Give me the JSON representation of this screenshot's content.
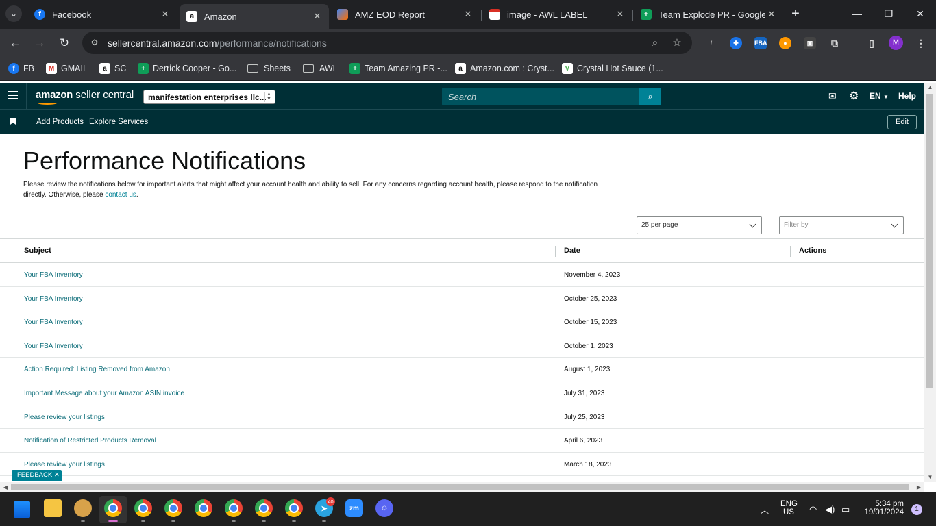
{
  "browser": {
    "tabs": [
      {
        "title": "Facebook",
        "icon": "facebook-icon",
        "color": "#1877f2",
        "glyph": "f"
      },
      {
        "title": "Amazon",
        "icon": "amazon-icon",
        "color": "#ffffff",
        "glyph": "a"
      },
      {
        "title": "AMZ EOD Report",
        "icon": "report-icon",
        "color": "#ff6f00",
        "glyph": ""
      },
      {
        "title": "image - AWL LABEL",
        "icon": "gmail-icon",
        "color": "#d93025",
        "glyph": ""
      },
      {
        "title": "Team Explode PR - Google S",
        "icon": "google-sheets-icon",
        "color": "#0f9d58",
        "glyph": "+"
      }
    ],
    "url_domain": "sellercentral.amazon.com",
    "url_path": "/performance/notifications",
    "profile_initial": "M",
    "bookmarks": [
      {
        "label": "FB",
        "icon": "facebook-icon"
      },
      {
        "label": "GMAIL",
        "icon": "gmail-icon"
      },
      {
        "label": "SC",
        "icon": "amazon-icon"
      },
      {
        "label": "Derrick Cooper - Go...",
        "icon": "google-sheets-icon"
      },
      {
        "label": "Sheets",
        "icon": "folder-icon"
      },
      {
        "label": "AWL",
        "icon": "folder-icon"
      },
      {
        "label": "Team Amazing PR -...",
        "icon": "google-sheets-icon"
      },
      {
        "label": "Amazon.com : Cryst...",
        "icon": "amazon-icon"
      },
      {
        "label": "Crystal Hot Sauce (1...",
        "icon": "vine-icon"
      }
    ]
  },
  "seller_central": {
    "logo_bold": "amazon",
    "logo_light": " seller central",
    "account": "manifestation enterprises llc...",
    "search_placeholder": "Search",
    "language": "EN",
    "help": "Help",
    "nav": [
      "Add Products",
      "Explore Services"
    ],
    "edit": "Edit"
  },
  "page": {
    "title": "Performance Notifications",
    "description": "Please review the notifications below for important alerts that might affect your account health and ability to sell. For any concerns regarding account health, please respond to the notification directly. Otherwise, please ",
    "contact_link": "contact us",
    "description_end": ".",
    "per_page": "25 per page",
    "filter_placeholder": "Filter by",
    "columns": {
      "subject": "Subject",
      "date": "Date",
      "actions": "Actions"
    },
    "rows": [
      {
        "subject": "Your FBA Inventory",
        "date": "November 4, 2023"
      },
      {
        "subject": "Your FBA Inventory",
        "date": "October 25, 2023"
      },
      {
        "subject": "Your FBA Inventory",
        "date": "October 15, 2023"
      },
      {
        "subject": "Your FBA Inventory",
        "date": "October 1, 2023"
      },
      {
        "subject": "Action Required: Listing Removed from Amazon",
        "date": "August 1, 2023"
      },
      {
        "subject": "Important Message about your Amazon ASIN invoice",
        "date": "July 31, 2023"
      },
      {
        "subject": "Please review your listings",
        "date": "July 25, 2023"
      },
      {
        "subject": "Notification of Restricted Products Removal",
        "date": "April 6, 2023"
      },
      {
        "subject": "Please review your listings",
        "date": "March 18, 2023"
      }
    ],
    "feedback": "FEEDBACK"
  },
  "taskbar": {
    "lang_top": "ENG",
    "lang_bottom": "US",
    "time": "5:34 pm",
    "date": "19/01/2024",
    "notification_count": "1",
    "telegram_badge": "40"
  }
}
